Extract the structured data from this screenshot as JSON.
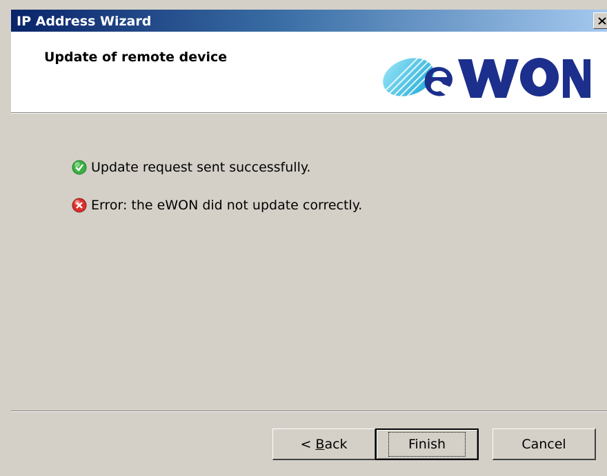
{
  "window": {
    "title": "IP Address Wizard",
    "close_symbol": "×"
  },
  "header": {
    "title": "Update of remote device",
    "logo_text": "eWON",
    "logo_alt": "eWON logo"
  },
  "messages": [
    {
      "icon": "success-check-icon",
      "text": "Update request sent successfully.",
      "color": "#3cb043"
    },
    {
      "icon": "error-x-icon",
      "text": "Error: the eWON did not update correctly.",
      "color": "#d9302c"
    }
  ],
  "buttons": {
    "back_prefix": "< ",
    "back_mnemonic": "B",
    "back_rest": "ack",
    "finish": "Finish",
    "cancel": "Cancel"
  },
  "colors": {
    "titlebar_start": "#0a246a",
    "titlebar_end": "#a6caf0",
    "face": "#d4d0c8",
    "logo_blue": "#1c2f8c",
    "logo_cyan": "#48c8e8"
  }
}
